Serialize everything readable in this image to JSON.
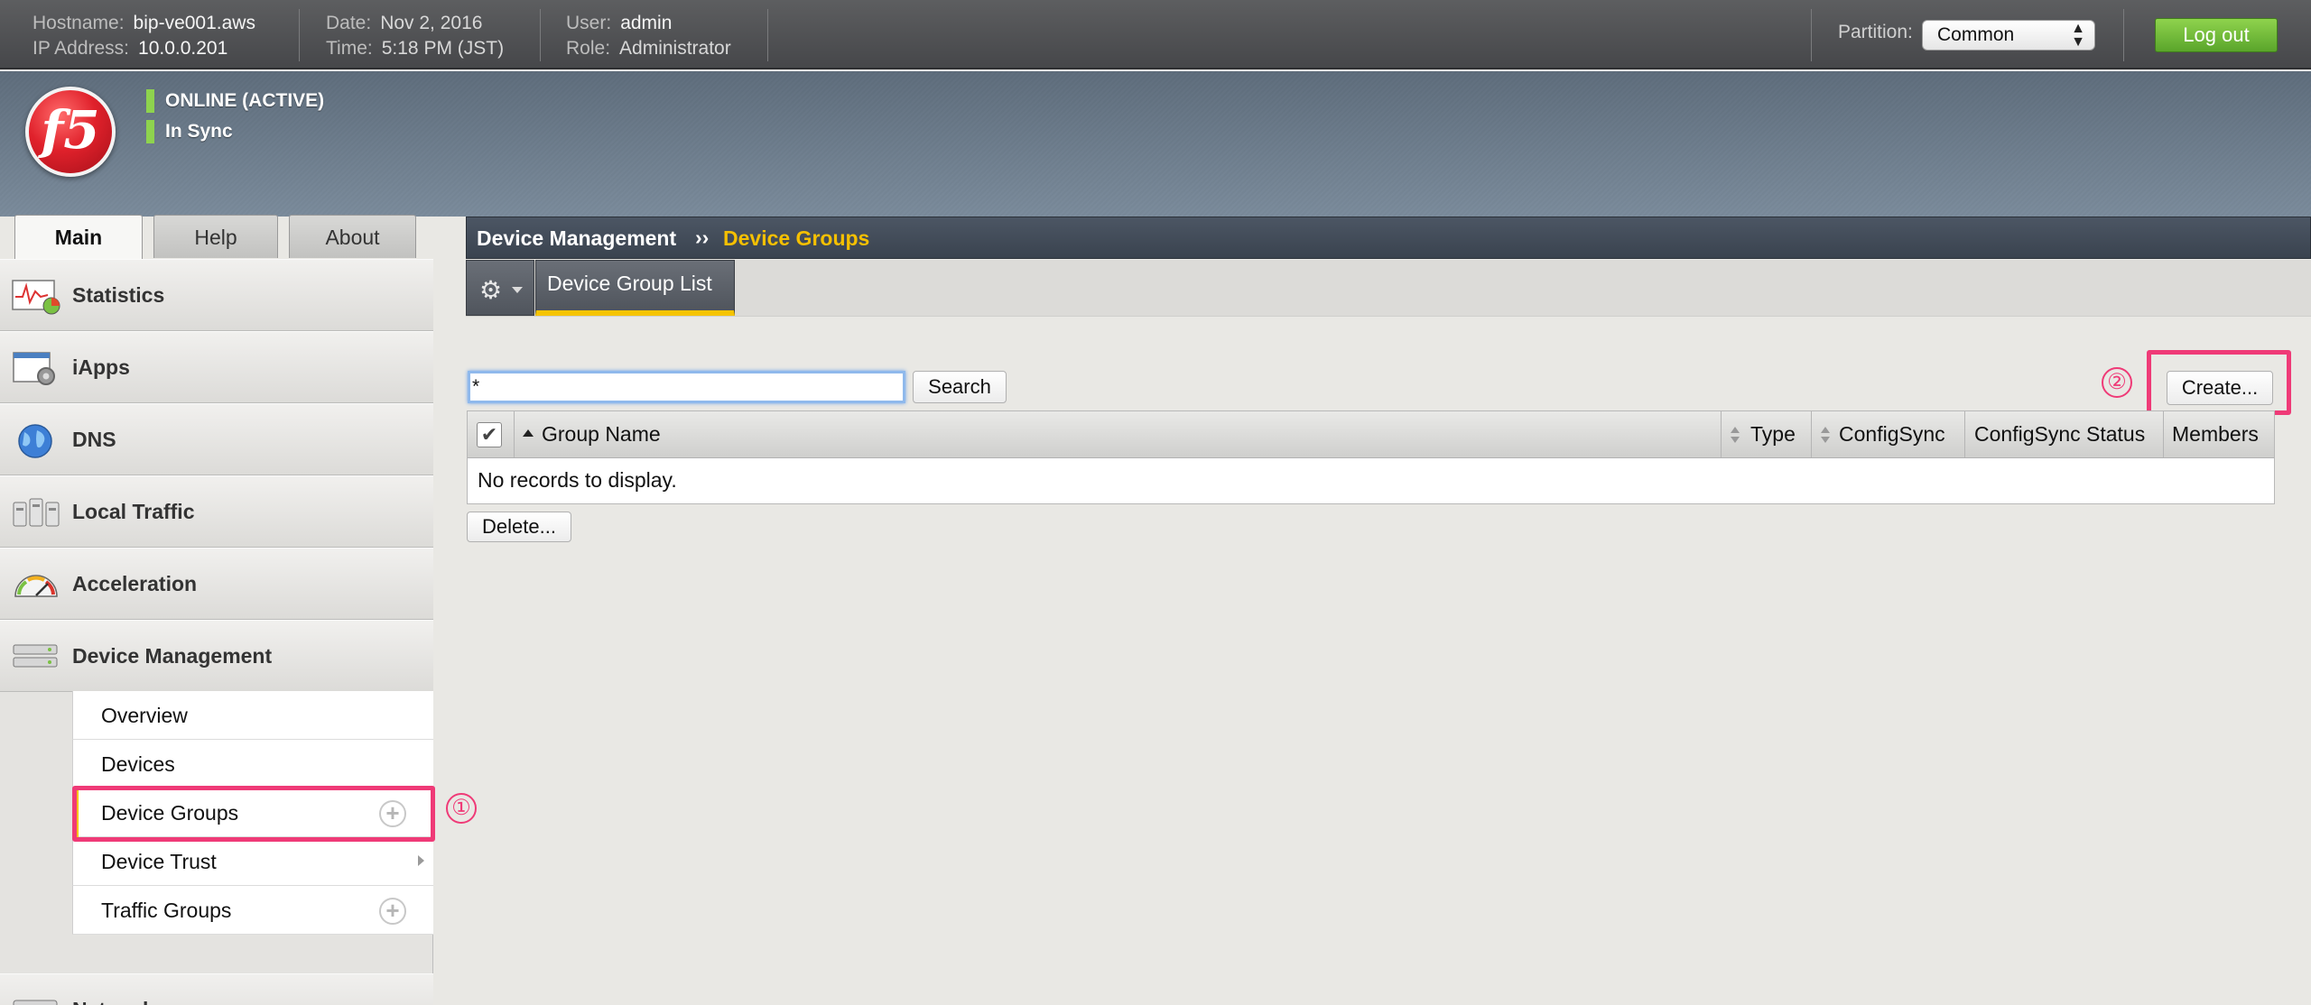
{
  "topbar": {
    "hostname_label": "Hostname:",
    "hostname": "bip-ve001.aws",
    "ip_label": "IP Address:",
    "ip": "10.0.0.201",
    "date_label": "Date:",
    "date": "Nov 2, 2016",
    "time_label": "Time:",
    "time": "5:18 PM (JST)",
    "user_label": "User:",
    "user": "admin",
    "role_label": "Role:",
    "role": "Administrator",
    "partition_label": "Partition:",
    "partition_value": "Common",
    "logout_label": "Log out"
  },
  "banner": {
    "logo_text": "f5",
    "status_online": "ONLINE (ACTIVE)",
    "status_sync": "In Sync",
    "status_color": "#8ed34e"
  },
  "tabs": {
    "main": "Main",
    "help": "Help",
    "about": "About"
  },
  "sidebar": {
    "items": [
      {
        "label": "Statistics",
        "icon": "statistics-icon"
      },
      {
        "label": "iApps",
        "icon": "iapps-icon"
      },
      {
        "label": "DNS",
        "icon": "dns-globe-icon"
      },
      {
        "label": "Local Traffic",
        "icon": "local-traffic-icon"
      },
      {
        "label": "Acceleration",
        "icon": "acceleration-gauge-icon"
      },
      {
        "label": "Device Management",
        "icon": "device-management-icon"
      },
      {
        "label": "Network",
        "icon": "network-icon"
      }
    ],
    "sub_items": [
      {
        "label": "Overview"
      },
      {
        "label": "Devices"
      },
      {
        "label": "Device Groups",
        "selected": true
      },
      {
        "label": "Device Trust"
      },
      {
        "label": "Traffic Groups"
      }
    ],
    "plus_glyph": "+"
  },
  "annotations": {
    "one": "①",
    "two": "②",
    "color": "#ef3a77"
  },
  "breadcrumb": {
    "parent": "Device Management",
    "separator": "››",
    "current": "Device Groups"
  },
  "subtabs": {
    "gear_glyph": "⚙",
    "active": "Device Group List"
  },
  "search": {
    "value": "*",
    "button": "Search"
  },
  "actions": {
    "create": "Create...",
    "delete": "Delete..."
  },
  "table": {
    "check_glyph": "✔",
    "columns": [
      "Group Name",
      "Type",
      "ConfigSync",
      "ConfigSync Status",
      "Members"
    ],
    "empty_text": "No records to display."
  },
  "colors": {
    "accent_yellow": "#f6c400",
    "logout_green": "#6cb935"
  }
}
